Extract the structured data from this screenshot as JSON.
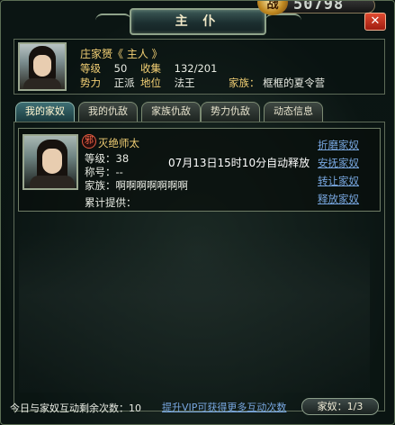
{
  "window": {
    "title": "主 仆",
    "close_label": "✕",
    "power_icon_text": "战",
    "power_value": "50798"
  },
  "player": {
    "name": "庄家赟《 主人 》",
    "level_label": "等级",
    "level_value": "50",
    "collect_label": "收集",
    "collect_value": "132/201",
    "faction_label": "势力",
    "faction_value": "正派",
    "rank_label": "地位",
    "rank_value": "法王",
    "family_label": "家族：",
    "family_value": "框框的夏令营"
  },
  "tabs": [
    {
      "label": "我的家奴",
      "active": true
    },
    {
      "label": "我的仇敌",
      "active": false
    },
    {
      "label": "家族仇敌",
      "active": false
    },
    {
      "label": "势力仇敌",
      "active": false
    },
    {
      "label": "动态信息",
      "active": false
    }
  ],
  "servant": {
    "faction_badge": "邪",
    "name": "灭绝师太",
    "level": "等级：38",
    "title": "称号：--",
    "family": "家族：啊啊啊啊啊啊啊",
    "contribution": "累计提供：",
    "release_time": "07月13日15时10分自动释放",
    "actions": [
      "折磨家奴",
      "安抚家奴",
      "转让家奴",
      "释放家奴"
    ]
  },
  "footer": {
    "remaining": "今日与家奴互动剩余次数：10",
    "vip_link": "提升VIP可获得更多互动次数",
    "servant_count": "家奴：1/3"
  },
  "colors": {
    "gold_text": "#f2cf74",
    "link_blue": "#78a7e0",
    "active_tab": "#3e6f74",
    "evil_badge": "#ff6a4a"
  }
}
